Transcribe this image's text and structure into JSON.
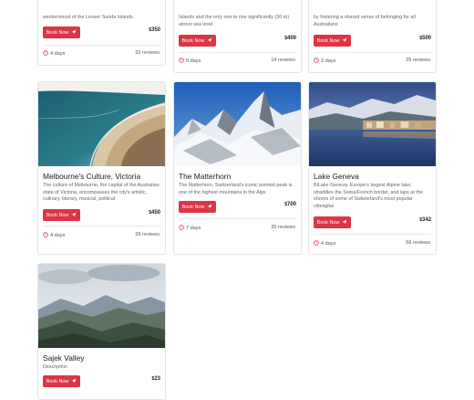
{
  "cards": [
    {
      "title": "",
      "description": "westernmost of the Lesser Sunda Islands",
      "book_label": "Book Now",
      "price": "350",
      "days": "4 days",
      "reviews": "32 reviews"
    },
    {
      "title": "",
      "description": "Islands and the only one to rise significantly (30 m) above sea level",
      "book_label": "Book Now",
      "price": "400",
      "days": "5 days",
      "reviews": "14 reviews"
    },
    {
      "title": "",
      "description": "by fostering a shared sense of belonging for all Australians",
      "book_label": "Book Now",
      "price": "500",
      "days": "3 days",
      "reviews": "25 reviews"
    },
    {
      "title": "Melbourne's Culture, Victoria",
      "description": "The culture of Melbourne, the capital of the Australian state of Victoria, encompasses the city's artistic, culinary, literary, musical, political",
      "book_label": "Book Now",
      "price": "450",
      "days": "4 days",
      "reviews": "26 reviews"
    },
    {
      "title": "The Matterhorn",
      "description": "The Matterhorn, Switzerland's iconic pointed peak is one of the highest mountains in the Alps",
      "book_label": "Book Now",
      "price": "700",
      "days": "7 days",
      "reviews": "35 reviews"
    },
    {
      "title": "Lake Geneva",
      "description": "BiLake Geneva, Europe's largest Alpine lake, straddles the Swiss/French border, and laps at the shores of some of Switzerland's most popular citiesgfax",
      "book_label": "Book Now",
      "price": "342",
      "days": "4 days",
      "reviews": "56 reviews"
    },
    {
      "title": "Sajek Valley",
      "description": "Description",
      "book_label": "Book Now",
      "price": "23",
      "days": "",
      "reviews": ""
    }
  ],
  "currency_symbol": "$",
  "icons": {
    "book": "send-icon",
    "days": "clock-icon"
  },
  "colors": {
    "accent": "#dc3545"
  }
}
